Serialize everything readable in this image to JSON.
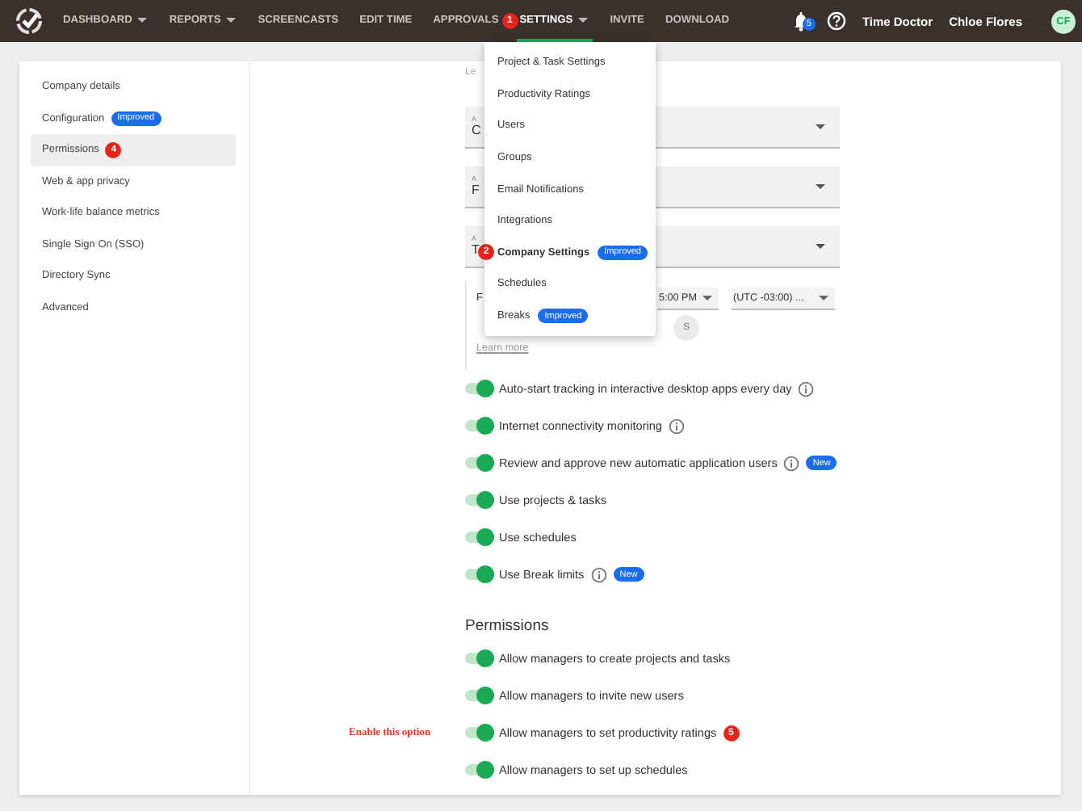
{
  "nav": {
    "items": [
      {
        "label": "DASHBOARD",
        "dropdown": true,
        "selected": false
      },
      {
        "label": "REPORTS",
        "dropdown": true,
        "selected": false
      },
      {
        "label": "SCREENCASTS",
        "dropdown": false,
        "selected": false
      },
      {
        "label": "EDIT TIME",
        "dropdown": false,
        "selected": false
      },
      {
        "label": "APPROVALS",
        "dropdown": false,
        "selected": false
      },
      {
        "label": "SETTINGS",
        "dropdown": true,
        "selected": true,
        "marker": "1"
      },
      {
        "label": "INVITE",
        "dropdown": false,
        "selected": false
      },
      {
        "label": "DOWNLOAD",
        "dropdown": false,
        "selected": false
      }
    ],
    "notification_count": "5",
    "company": "Time Doctor",
    "user": "Chloe Flores",
    "avatar": "CF"
  },
  "settings_menu": [
    {
      "label": "Project & Task Settings",
      "selected": false
    },
    {
      "label": "Productivity Ratings",
      "selected": false
    },
    {
      "label": "Users",
      "selected": false
    },
    {
      "label": "Groups",
      "selected": false
    },
    {
      "label": "Email Notifications",
      "selected": false
    },
    {
      "label": "Integrations",
      "selected": false
    },
    {
      "label": "Company Settings",
      "selected": true,
      "badge": "Improved",
      "marker": "2"
    },
    {
      "label": "Schedules",
      "selected": false
    },
    {
      "label": "Breaks",
      "selected": false,
      "badge": "Improved"
    }
  ],
  "sidebar": {
    "items": [
      {
        "label": "Company details",
        "selected": false
      },
      {
        "label": "Configuration",
        "selected": false,
        "badge": "Improved"
      },
      {
        "label": "Permissions",
        "selected": true,
        "marker": "4"
      },
      {
        "label": "Web & app privacy",
        "selected": false
      },
      {
        "label": "Work-life balance metrics",
        "selected": false
      },
      {
        "label": "Single Sign On (SSO)",
        "selected": false
      },
      {
        "label": "Directory Sync",
        "selected": false
      },
      {
        "label": "Advanced",
        "selected": false
      }
    ]
  },
  "content": {
    "top_link": "Le",
    "fields": [
      {
        "label": "A",
        "value": "C"
      },
      {
        "label": "A",
        "value": "F"
      },
      {
        "label": "A",
        "value": "T"
      }
    ],
    "schedule": {
      "label": "F",
      "selects": [
        "5:00 PM",
        "(UTC -03:00) ..."
      ],
      "days": [
        {
          "label": "S",
          "selected": false
        }
      ],
      "link": "Learn more"
    },
    "toggles": [
      {
        "label": "Auto-start tracking in interactive desktop apps every day",
        "on": true,
        "info": true
      },
      {
        "label": "Internet connectivity monitoring",
        "on": true,
        "info": true
      },
      {
        "label": "Review and approve new automatic application users",
        "on": true,
        "info": true,
        "badge": "New"
      },
      {
        "label": "Use projects & tasks",
        "on": true,
        "info": false
      },
      {
        "label": "Use schedules",
        "on": true,
        "info": false
      },
      {
        "label": "Use Break limits",
        "on": true,
        "info": true,
        "badge": "New"
      }
    ],
    "permissions": {
      "title": "Permissions",
      "toggles": [
        {
          "label": "Allow managers to create projects and tasks",
          "on": true
        },
        {
          "label": "Allow managers to invite new users",
          "on": true
        },
        {
          "label": "Allow managers to set productivity ratings",
          "on": true,
          "marker": "5",
          "note": "Enable this option"
        },
        {
          "label": "Allow managers to set up schedules",
          "on": true
        }
      ]
    }
  }
}
